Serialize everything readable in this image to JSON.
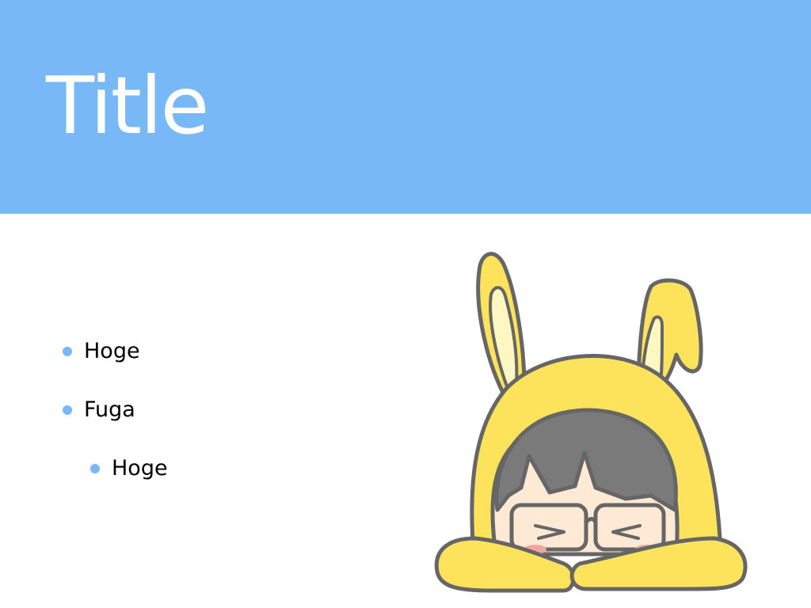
{
  "slide": {
    "title": "Title",
    "bullets": [
      {
        "text": "Hoge",
        "level": 1
      },
      {
        "text": "Fuga",
        "level": 1
      },
      {
        "text": "Hoge",
        "level": 2
      }
    ]
  },
  "colors": {
    "header": "#78b8f7",
    "bullet_dot": "#78b8f7",
    "hood": "#fde35c",
    "outline": "#666666"
  },
  "icons": {
    "illustration": "bunny-hood-character-icon"
  }
}
